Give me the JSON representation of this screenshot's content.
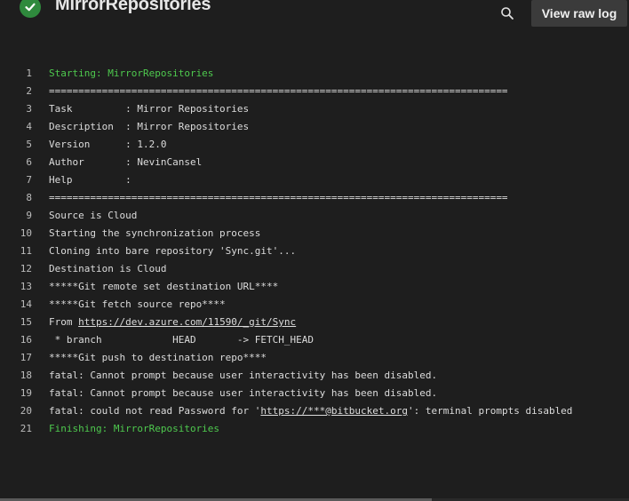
{
  "header": {
    "title": "MirrorRepositories",
    "status_icon": "check-circle-icon",
    "status_color": "#2f8a3d",
    "search_icon": "search-icon",
    "view_raw_label": "View raw log"
  },
  "log": {
    "lines": [
      {
        "num": "1",
        "text": "Starting: MirrorRepositories"
      },
      {
        "num": "2",
        "text": "=============================================================================="
      },
      {
        "num": "3",
        "text": "Task         : Mirror Repositories"
      },
      {
        "num": "4",
        "text": "Description  : Mirror Repositories"
      },
      {
        "num": "5",
        "text": "Version      : 1.2.0"
      },
      {
        "num": "6",
        "text": "Author       : NevinCansel"
      },
      {
        "num": "7",
        "text": "Help         :"
      },
      {
        "num": "8",
        "text": "=============================================================================="
      },
      {
        "num": "9",
        "text": "Source is Cloud"
      },
      {
        "num": "10",
        "text": "Starting the synchronization process"
      },
      {
        "num": "11",
        "text": "Cloning into bare repository 'Sync.git'..."
      },
      {
        "num": "12",
        "text": "Destination is Cloud"
      },
      {
        "num": "13",
        "text": "*****Git remote set destination URL****"
      },
      {
        "num": "14",
        "text": "*****Git fetch source repo****"
      },
      {
        "num": "15",
        "prefix": "From ",
        "link": "https://dev.azure.com/11590/_git/Sync",
        "suffix": ""
      },
      {
        "num": "16",
        "text": " * branch            HEAD       -> FETCH_HEAD"
      },
      {
        "num": "17",
        "text": "*****Git push to destination repo****"
      },
      {
        "num": "18",
        "text": "fatal: Cannot prompt because user interactivity has been disabled."
      },
      {
        "num": "19",
        "text": "fatal: Cannot prompt because user interactivity has been disabled."
      },
      {
        "num": "20",
        "prefix": "fatal: could not read Password for '",
        "link": "https://***@bitbucket.org",
        "suffix": "': terminal prompts disabled"
      },
      {
        "num": "21",
        "text": "Finishing: MirrorRepositories"
      }
    ],
    "highlight_color": "#4ec94e"
  }
}
